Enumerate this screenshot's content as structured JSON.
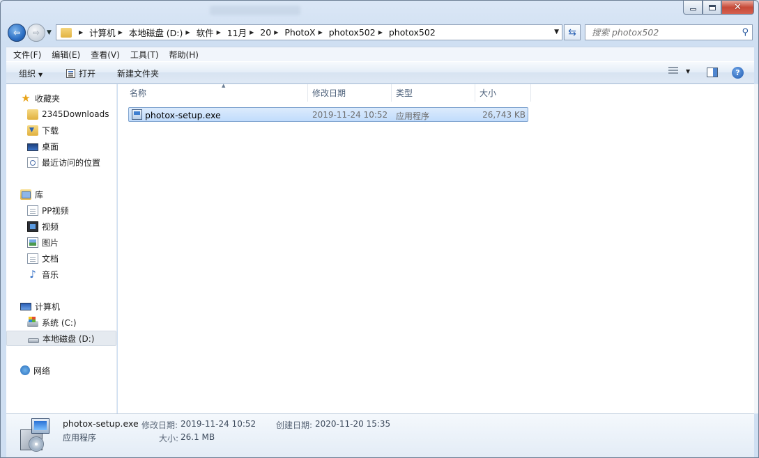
{
  "window": {
    "close_glyph": "✕",
    "title_hint": ""
  },
  "nav": {
    "back_glyph": "⇦",
    "forward_glyph": "⇨",
    "breadcrumb": [
      "计算机",
      "本地磁盘 (D:)",
      "软件",
      "11月",
      "20",
      "PhotoX",
      "photox502",
      "photox502"
    ],
    "search_placeholder": "搜索 photox502"
  },
  "menu": [
    "文件(F)",
    "编辑(E)",
    "查看(V)",
    "工具(T)",
    "帮助(H)"
  ],
  "commands": {
    "organize": "组织",
    "open": "打开",
    "new_folder": "新建文件夹",
    "help_glyph": "?"
  },
  "sidebar": {
    "favorites": {
      "label": "收藏夹",
      "items": [
        "2345Downloads",
        "下载",
        "桌面",
        "最近访问的位置"
      ]
    },
    "libraries": {
      "label": "库",
      "items": [
        "PP视频",
        "视频",
        "图片",
        "文档",
        "音乐"
      ]
    },
    "computer": {
      "label": "计算机",
      "items": [
        "系统 (C:)",
        "本地磁盘 (D:)"
      ]
    },
    "network": {
      "label": "网络"
    }
  },
  "columns": [
    "名称",
    "修改日期",
    "类型",
    "大小"
  ],
  "files": [
    {
      "name": "photox-setup.exe",
      "modified": "2019-11-24 10:52",
      "type": "应用程序",
      "size": "26,743 KB"
    }
  ],
  "details": {
    "name": "photox-setup.exe",
    "type": "应用程序",
    "modified_label": "修改日期:",
    "modified": "2019-11-24 10:52",
    "created_label": "创建日期:",
    "created": "2020-11-20 15:35",
    "size_label": "大小:",
    "size": "26.1 MB"
  }
}
